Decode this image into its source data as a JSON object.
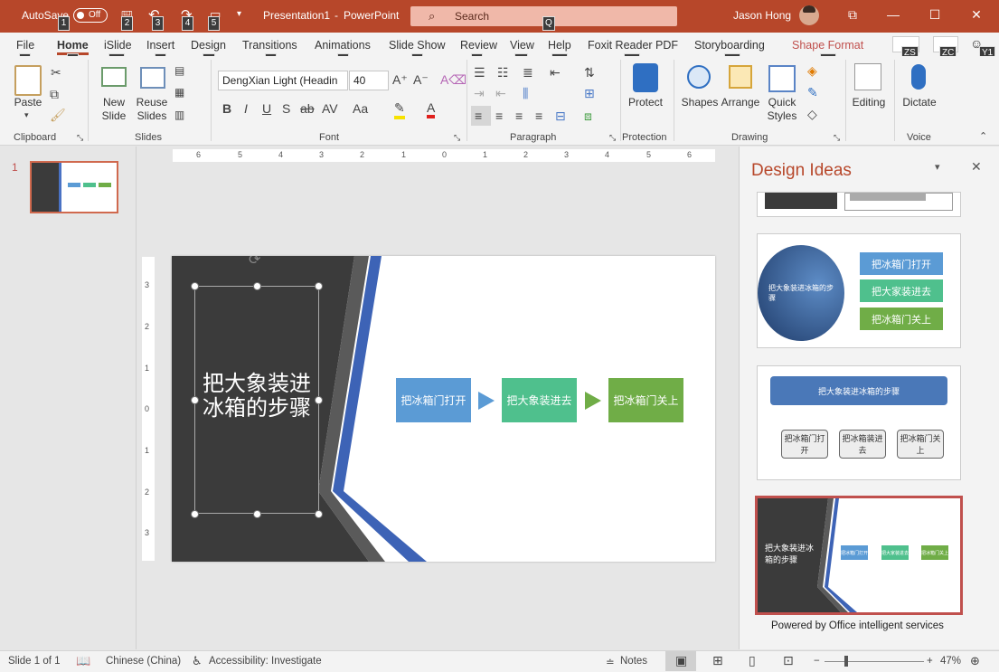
{
  "titlebar": {
    "autosave": "AutoSave",
    "autosave_state": "Off",
    "doc_title": "Presentation1",
    "separator": "-",
    "app_name": "PowerPoint",
    "search_placeholder": "Search",
    "user_name": "Jason Hong"
  },
  "keytips": {
    "autosave": "1",
    "save": "2",
    "undo": "3",
    "redo": "4",
    "start": "5",
    "search": "Q",
    "file": "F",
    "home": "H",
    "islide": "Y2",
    "insert": "N",
    "design": "G",
    "transitions": "K",
    "animations": "A",
    "slideshow": "S",
    "review": "R",
    "view": "W",
    "help": "Y3",
    "foxit": "Y4",
    "storyboarding": "Y5",
    "shapeformat": "JD",
    "share": "ZS",
    "comments": "ZC",
    "feedback": "Y1"
  },
  "tabs": [
    "File",
    "Home",
    "iSlide",
    "Insert",
    "Design",
    "Transitions",
    "Animations",
    "Slide Show",
    "Review",
    "View",
    "Help",
    "Foxit Reader PDF",
    "Storyboarding",
    "Shape Format"
  ],
  "ribbon": {
    "clipboard": {
      "paste": "Paste",
      "group": "Clipboard"
    },
    "slides": {
      "new_slide": "New\nSlide",
      "reuse": "Reuse\nSlides",
      "group": "Slides"
    },
    "font": {
      "font_name": "DengXian Light (Headin",
      "font_size": "40",
      "group": "Font"
    },
    "paragraph": {
      "group": "Paragraph"
    },
    "protection": {
      "protect": "Protect",
      "group": "Protection"
    },
    "drawing": {
      "shapes": "Shapes",
      "arrange": "Arrange",
      "quick_styles": "Quick\nStyles",
      "group": "Drawing"
    },
    "editing": {
      "label": "Editing"
    },
    "voice": {
      "dictate": "Dictate",
      "group": "Voice"
    }
  },
  "thumbnails": {
    "slide_number": "1"
  },
  "slide": {
    "title": "把大象装进冰箱的步骤",
    "steps": [
      "把冰箱门打开",
      "把大象装进去",
      "把冰箱门关上"
    ],
    "step_colors": [
      "#5b9bd5",
      "#4fc08d",
      "#70ad47"
    ]
  },
  "ruler_h": [
    "6",
    "5",
    "4",
    "3",
    "2",
    "1",
    "0",
    "1",
    "2",
    "3",
    "4",
    "5",
    "6"
  ],
  "ruler_v": [
    "3",
    "2",
    "1",
    "0",
    "1",
    "2",
    "3"
  ],
  "design_ideas": {
    "title": "Design Ideas",
    "idea2": {
      "title": "把大象装进冰箱的步骤",
      "steps": [
        "把冰箱门打开",
        "把大家装进去",
        "把冰箱门关上"
      ]
    },
    "idea3": {
      "title": "把大象装进冰箱的步骤",
      "steps": [
        "把冰箱门打开",
        "把冰箱装进去",
        "把冰箱门关上"
      ]
    },
    "idea4": {
      "title": "把大象装进冰箱的步骤",
      "steps": [
        "把冰箱门打开",
        "把大家装进去",
        "把冰箱门关上"
      ]
    },
    "footer": "Powered by Office intelligent services"
  },
  "status": {
    "slide": "Slide 1 of 1",
    "language": "Chinese (China)",
    "accessibility": "Accessibility: Investigate",
    "notes": "Notes",
    "zoom": "47%"
  }
}
